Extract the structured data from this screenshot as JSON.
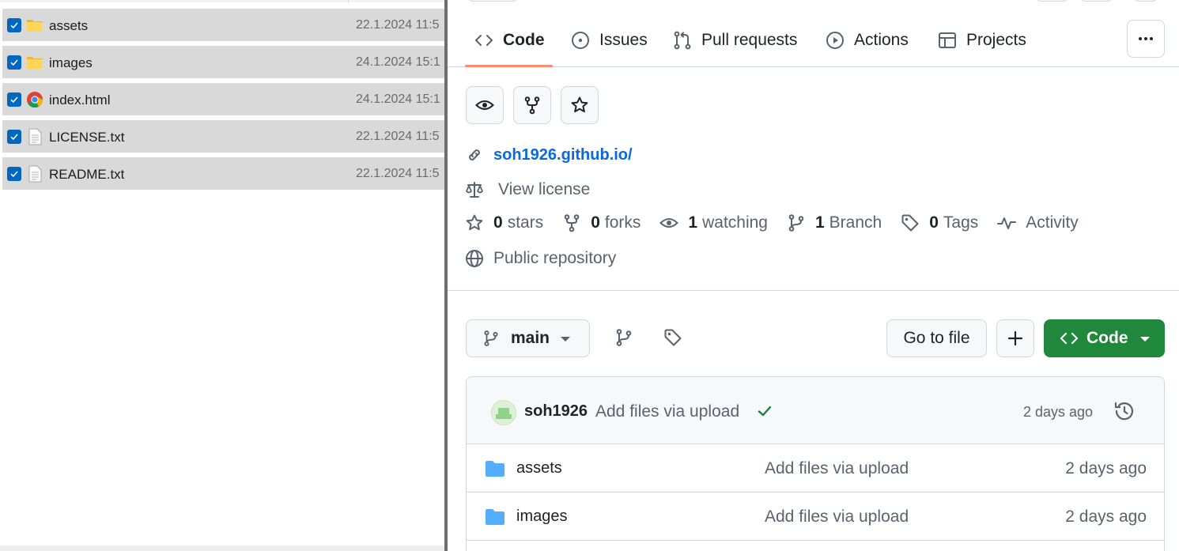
{
  "explorer": {
    "files": [
      {
        "name": "assets",
        "date": "22.1.2024 11:5",
        "type": "folder",
        "icon": "folder-icon",
        "checked": true
      },
      {
        "name": "images",
        "date": "24.1.2024 15:1",
        "type": "folder",
        "icon": "folder-icon",
        "checked": true
      },
      {
        "name": "index.html",
        "date": "24.1.2024 15:1",
        "type": "html",
        "icon": "chrome-icon",
        "checked": true
      },
      {
        "name": "LICENSE.txt",
        "date": "22.1.2024 11:5",
        "type": "text",
        "icon": "text-file-icon",
        "checked": true
      },
      {
        "name": "README.txt",
        "date": "22.1.2024 11:5",
        "type": "text",
        "icon": "text-file-icon",
        "checked": true
      }
    ]
  },
  "github": {
    "tabs": [
      {
        "label": "Code",
        "icon": "code-icon",
        "active": true
      },
      {
        "label": "Issues",
        "icon": "issue-icon",
        "active": false
      },
      {
        "label": "Pull requests",
        "icon": "pull-request-icon",
        "active": false
      },
      {
        "label": "Actions",
        "icon": "play-icon",
        "active": false
      },
      {
        "label": "Projects",
        "icon": "table-icon",
        "active": false
      }
    ],
    "repo": {
      "link": "soh1926.github.io/",
      "license": "View license",
      "visibility": "Public repository"
    },
    "stats": {
      "stars_count": "0",
      "stars_label": "stars",
      "forks_count": "0",
      "forks_label": "forks",
      "watching_count": "1",
      "watching_label": "watching",
      "branch_count": "1",
      "branch_label": "Branch",
      "tags_count": "0",
      "tags_label": "Tags",
      "activity_label": "Activity"
    },
    "toolbar": {
      "branch": "main",
      "go_to_file": "Go to file",
      "code_button": "Code"
    },
    "commit": {
      "user": "soh1926",
      "message": "Add files via upload",
      "time": "2 days ago"
    },
    "files": [
      {
        "name": "assets",
        "message": "Add files via upload",
        "time": "2 days ago"
      },
      {
        "name": "images",
        "message": "Add files via upload",
        "time": "2 days ago"
      }
    ],
    "colors": {
      "accent_link": "#0969da",
      "code_button": "#1f883d",
      "tab_underline": "#fd8c73",
      "folder": "#54aeff"
    }
  }
}
